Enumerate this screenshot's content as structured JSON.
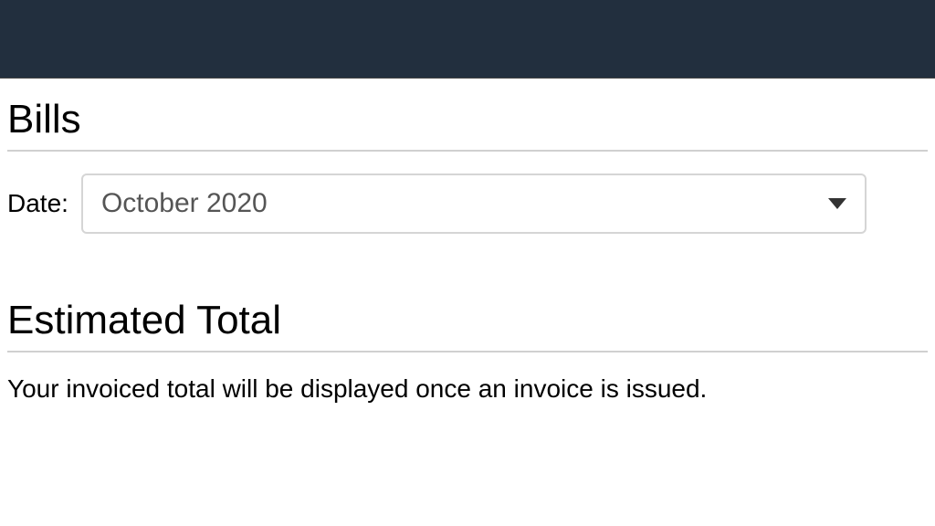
{
  "bills": {
    "title": "Bills",
    "date_label": "Date:",
    "date_value": "October 2020"
  },
  "estimated": {
    "title": "Estimated Total",
    "message": "Your invoiced total will be displayed once an invoice is issued."
  }
}
